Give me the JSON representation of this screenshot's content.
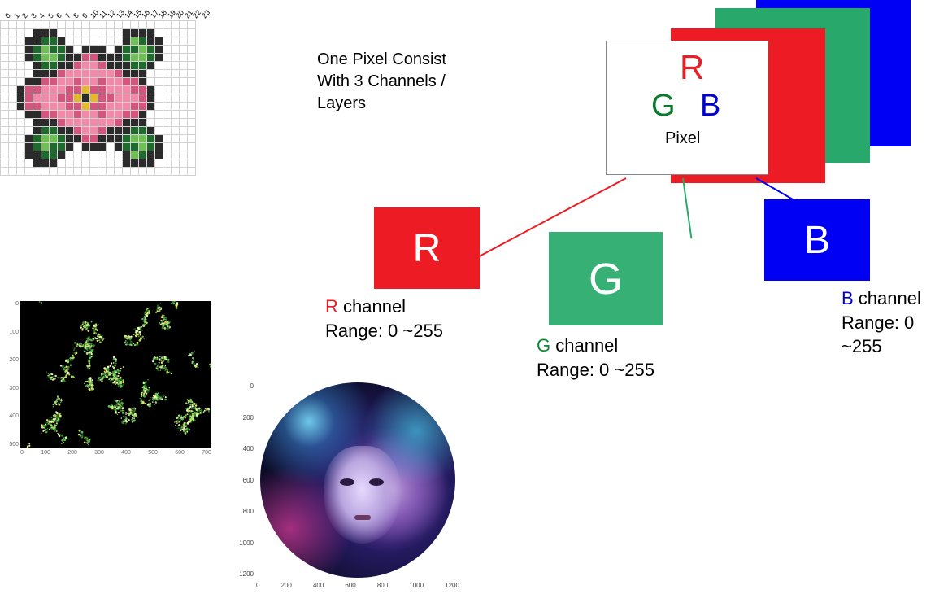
{
  "caption": {
    "line1": "One Pixel Consist",
    "line2": "With 3 Channels /",
    "line3": " Layers"
  },
  "pixel_box": {
    "r": "R",
    "g": "G",
    "b": "B",
    "label": "Pixel"
  },
  "channels": {
    "r": {
      "letter": "R",
      "label_colored": "R",
      "label_rest": " channel",
      "range": "Range: 0 ~255"
    },
    "g": {
      "letter": "G",
      "label_colored": "G",
      "label_rest": " channel",
      "range": "Range: 0 ~255"
    },
    "b": {
      "letter": "B",
      "label_colored": "B",
      "label_rest": " channel",
      "range": "Range: 0 ~255"
    }
  },
  "pixelart": {
    "col_labels": [
      "0",
      "1",
      "2",
      "3",
      "4",
      "5",
      "6",
      "7",
      "8",
      "9",
      "10",
      "11",
      "12",
      "13",
      "14",
      "15",
      "16",
      "17",
      "18",
      "19",
      "20",
      "21",
      "22",
      "23"
    ],
    "grid": [
      "........................",
      "....KKK........KKKK.....",
      "...KKGGK.......KLGKK....",
      "...KGLGGK.KKK.KGGLGK....",
      "...KGLLGKKDDKKKGLLGK....",
      "....KGGKKDPPDKKKGGK.....",
      "....KKKDPPPPPPDKKK......",
      "...KKDDPPDPPDPPDDK......",
      "..KDDPPPDDYDDPPPDDK.....",
      "..KDPPPDDYKYDDPPPDK.....",
      "..KDDPPPDDYDDPPPDDK.....",
      "...KKDDPPDPPDPPDDK......",
      "....KKKDPPPPPPDKKK......",
      "....KGGKKDPPDKKKGGK.....",
      "...KGLLGKKDDKKKGLLGK....",
      "...KGLGGK.KKK.KGGLGK....",
      "...KKGGK.......KLGKK....",
      "....KKK........KKKK.....",
      "........................"
    ]
  },
  "darkplot": {
    "x_ticks": [
      "0",
      "100",
      "200",
      "300",
      "400",
      "500",
      "600",
      "700"
    ],
    "y_ticks": [
      "0",
      "100",
      "200",
      "300",
      "400",
      "500"
    ]
  },
  "circplot": {
    "x_ticks": [
      "0",
      "200",
      "400",
      "600",
      "800",
      "1000",
      "1200"
    ],
    "y_ticks": [
      "0",
      "200",
      "400",
      "600",
      "800",
      "1000",
      "1200"
    ]
  }
}
